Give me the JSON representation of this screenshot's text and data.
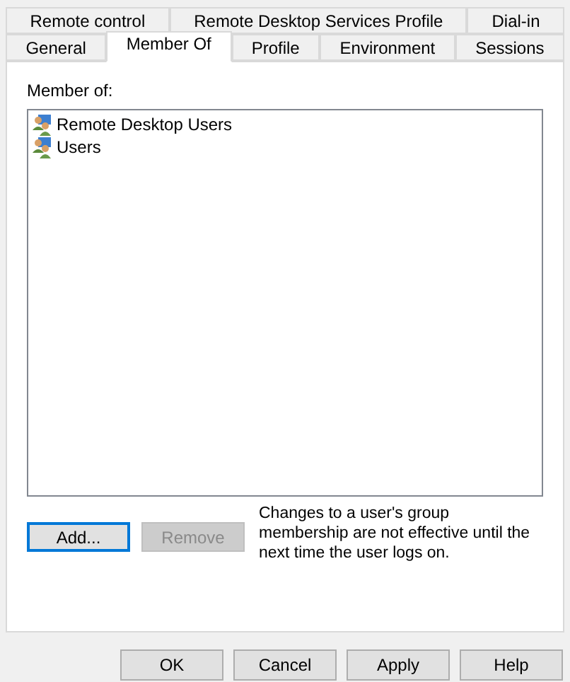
{
  "tab_rows": [
    [
      {
        "label": "Remote control",
        "selected": false
      },
      {
        "label": "Remote Desktop Services Profile",
        "selected": false
      },
      {
        "label": "Dial-in",
        "selected": false
      }
    ],
    [
      {
        "label": "General",
        "selected": false
      },
      {
        "label": "Member Of",
        "selected": true
      },
      {
        "label": "Profile",
        "selected": false
      },
      {
        "label": "Environment",
        "selected": false
      },
      {
        "label": "Sessions",
        "selected": false
      }
    ]
  ],
  "member_of": {
    "label": "Member of:",
    "items": [
      {
        "name": "Remote Desktop Users"
      },
      {
        "name": "Users"
      }
    ]
  },
  "actions": [
    {
      "label": "Add...",
      "disabled": false,
      "focused": true
    },
    {
      "label": "Remove",
      "disabled": true,
      "focused": false
    }
  ],
  "note": "Changes to a user's group membership are not effective until the next time the user logs on.",
  "buttons": [
    {
      "label": "OK"
    },
    {
      "label": "Cancel"
    },
    {
      "label": "Apply"
    },
    {
      "label": "Help"
    }
  ]
}
